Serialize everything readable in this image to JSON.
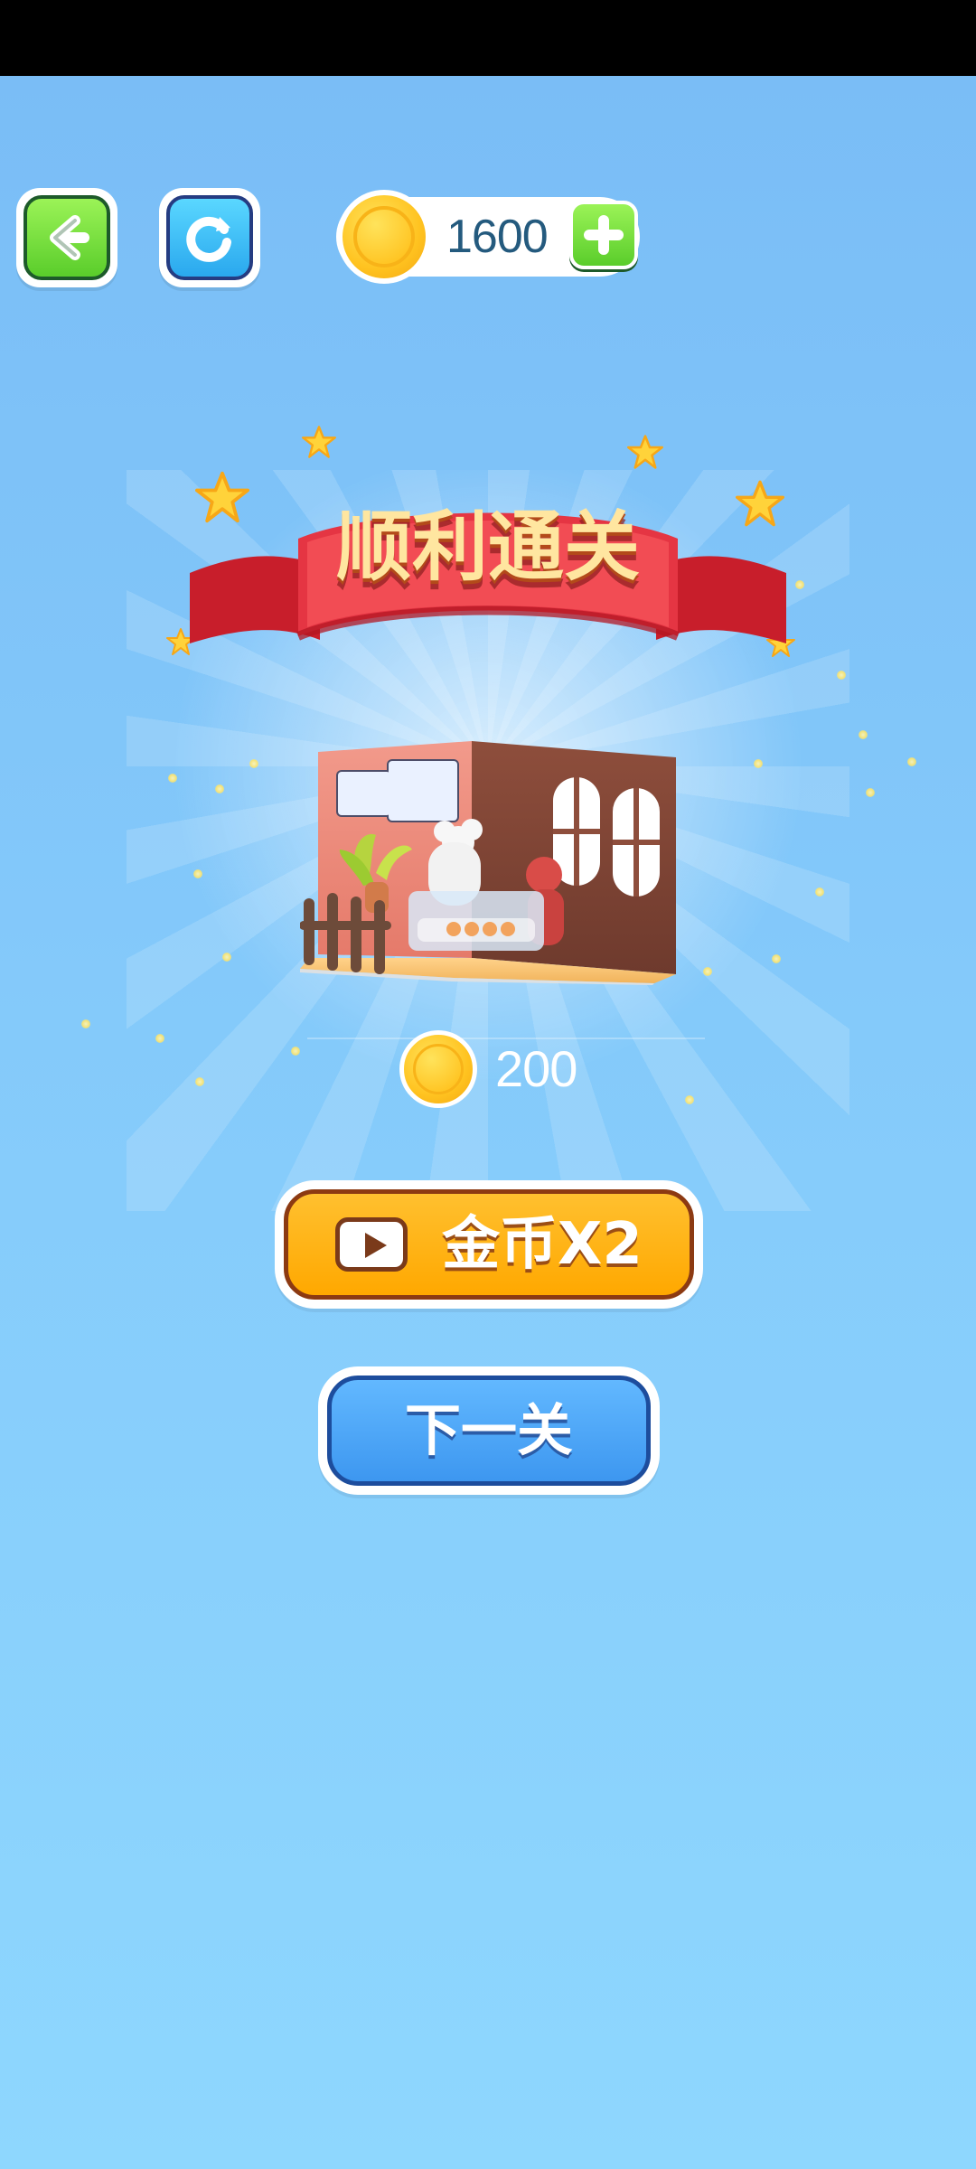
{
  "header": {
    "coin_balance": "1600"
  },
  "banner": {
    "title": "顺利通关"
  },
  "reward": {
    "coin_amount": "200"
  },
  "actions": {
    "double_coins_label": "金币X2",
    "next_level_label": "下一关"
  },
  "icons": {
    "back": "back-arrow-icon",
    "restart": "restart-icon",
    "coin": "coin-icon",
    "add": "plus-icon",
    "video": "video-play-icon"
  },
  "colors": {
    "background_top": "#79BCF6",
    "background_bottom": "#8ED7FE",
    "green_button": "#5ACD2B",
    "blue_button": "#3D97F0",
    "orange_button": "#FFA800",
    "coin_text": "#245A7E",
    "ribbon_red": "#D92E3A"
  }
}
